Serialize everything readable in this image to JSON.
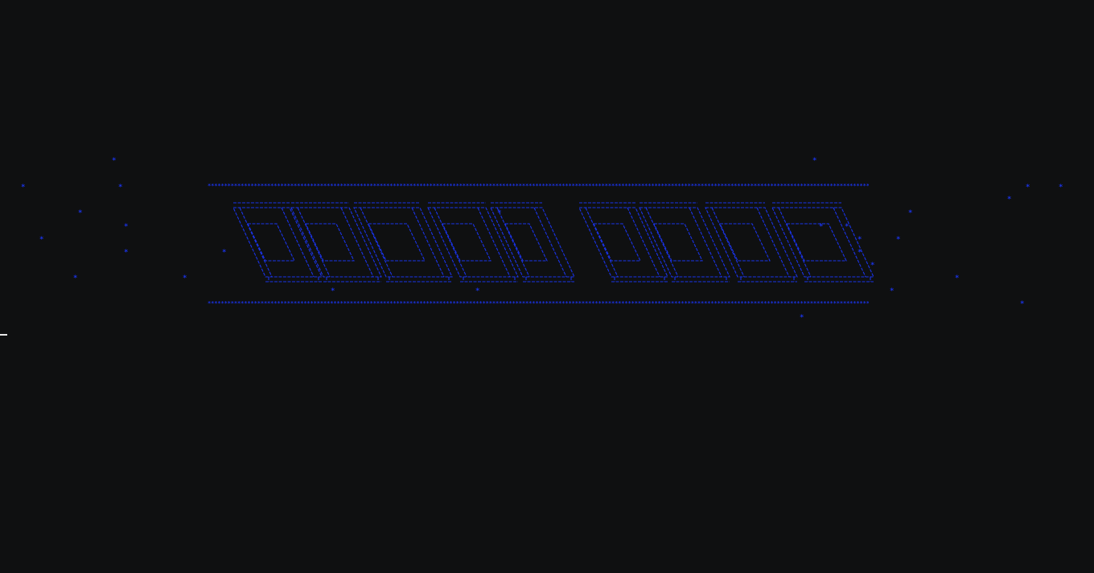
{
  "terminal": {
    "background": "#0f1011",
    "accent": "#1a33e6",
    "border_glyph": "*",
    "star_glyph": "*",
    "cursor": "_"
  },
  "banner": {
    "art_rows": [
      "   ____    ___    __  __   ___  _         ___    ___   _  _    ___  ",
      "  / ___|  / _ \\  |  \\/  | / _ \\| |       |_  )  / _ \\ | || |  ( _ ) ",
      " | |     | | | | | |\\/| || |_| | |        / /  | | | || || |_ / _ \\ ",
      " | |___  | |_| | | |  | ||  _  | |___    / /_  | |_| ||__   _| (_) |",
      "  \\____|  \\___/  |_|  |_||_| |_|_____|  |____|  \\___/    |_|  \\___/ "
    ]
  }
}
